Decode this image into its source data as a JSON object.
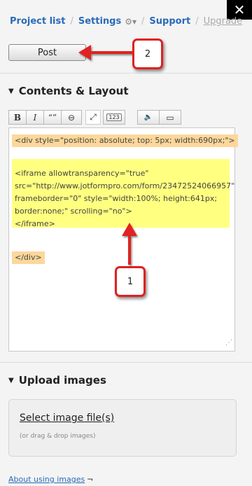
{
  "nav": {
    "project_list": "Project list",
    "settings": "Settings",
    "settings_gear": "⚙▾",
    "support": "Support",
    "upgrade": "Upgrade",
    "separator": "/",
    "close": "✕"
  },
  "post_button": "Post",
  "contents_section": {
    "title": "Contents & Layout",
    "toolbar": {
      "bold": "B",
      "italic": "I",
      "quote": "“”",
      "link": "⊖",
      "expand": "⤢",
      "numbered": "123",
      "audio": "🔈",
      "video": "▭"
    },
    "editor": {
      "line_div_open": "<div style=\"position: absolute; top: 5px; width:690px;\">",
      "iframe_lines": "<iframe allowtransparency=\"true\"\nsrc=\"http://www.jotformpro.com/form/23472524066957\"\nframeborder=\"0\" style=\"width:100%; height:641px;\nborder:none;\" scrolling=\"no\">\n</iframe>",
      "line_div_close": "</div>"
    }
  },
  "upload_section": {
    "title": "Upload images",
    "select_link": "Select image file(s)",
    "hint": "(or drag & drop images)"
  },
  "about_link": "About using images",
  "about_arrow": "¬",
  "annotations": {
    "badge_1": "1",
    "badge_2": "2",
    "arrow_color": "#e02020"
  },
  "colors": {
    "link_blue": "#2a6bb8",
    "highlight_orange": "#fdd79a",
    "highlight_yellow": "#ffff80"
  }
}
